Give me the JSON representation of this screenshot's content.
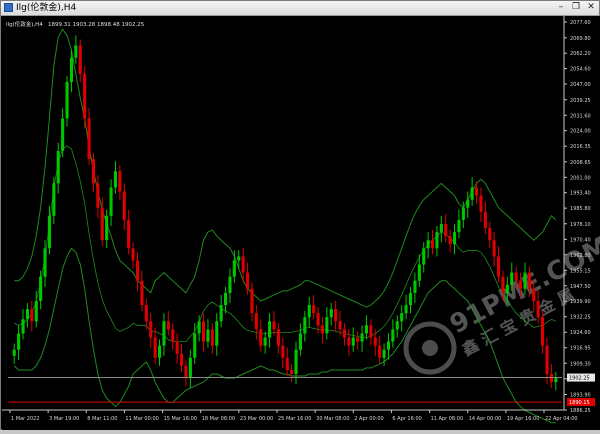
{
  "window": {
    "title": "Ilg(伦敦金),H4",
    "minimize_label": "–",
    "restore_label": "❐",
    "close_label": "✕"
  },
  "info_line": {
    "symbol": "Ilg(伦敦金),H4",
    "ohlc": "1899.31 1903.28 1898.48 1902.25"
  },
  "watermark": {
    "line1": "91PME.COM",
    "line2": "鑫 汇 宝 贵 金 属"
  },
  "colors": {
    "background": "#000000",
    "bull_candle": "#00c800",
    "bear_candle": "#e00000",
    "bands": "#1f8a1f",
    "grid_axis": "#c8c8c8",
    "bid_line": "#8a8a8a",
    "ask_line": "#e00000"
  },
  "icons": {
    "app": "chart-window-icon"
  },
  "chart_data": {
    "type": "candlestick",
    "price_levels": [
      "2077.60",
      "2069.80",
      "2062.20",
      "2054.60",
      "2047.00",
      "2039.25",
      "2031.60",
      "2024.00",
      "2016.35",
      "2008.65",
      "2001.00",
      "1993.40",
      "1985.80",
      "1978.10",
      "1970.40",
      "1962.80",
      "1955.15",
      "1947.50",
      "1939.90",
      "1932.25",
      "1924.60",
      "1916.95",
      "1909.30",
      "1901.60",
      "1893.90",
      "1886.25"
    ],
    "time_labels": [
      "1 Mar 2022",
      "3 Mar 19:00",
      "8 Mar 11:00",
      "11 Mar 00:00",
      "15 Mar 16:00",
      "18 Mar 08:00",
      "23 Mar 00:00",
      "25 Mar 16:00",
      "30 Mar 08:00",
      "2 Apr 00:00",
      "6 Apr 16:00",
      "11 Apr 08:00",
      "14 Apr 00:00",
      "19 Apr 16:00",
      "22 Apr 04:00"
    ],
    "bid_label": "1902.25",
    "ask_label": "1890.15",
    "closes": [
      1916,
      1924,
      1931,
      1936,
      1930,
      1940,
      1952,
      1966,
      1982,
      1998,
      2014,
      2030,
      2048,
      2060,
      2066,
      2052,
      2030,
      2010,
      1998,
      1986,
      1970,
      1982,
      1996,
      2004,
      1994,
      1980,
      1966,
      1960,
      1950,
      1938,
      1930,
      1922,
      1912,
      1918,
      1930,
      1926,
      1920,
      1914,
      1908,
      1902,
      1912,
      1924,
      1930,
      1920,
      1926,
      1918,
      1930,
      1938,
      1944,
      1952,
      1960,
      1962,
      1954,
      1946,
      1934,
      1926,
      1918,
      1922,
      1930,
      1926,
      1918,
      1912,
      1906,
      1904,
      1916,
      1924,
      1932,
      1938,
      1934,
      1928,
      1924,
      1932,
      1936,
      1930,
      1926,
      1922,
      1918,
      1922,
      1920,
      1924,
      1928,
      1922,
      1918,
      1912,
      1916,
      1920,
      1926,
      1930,
      1934,
      1938,
      1944,
      1950,
      1958,
      1966,
      1970,
      1966,
      1974,
      1978,
      1972,
      1968,
      1974,
      1980,
      1986,
      1990,
      1996,
      1992,
      1984,
      1976,
      1970,
      1962,
      1952,
      1944,
      1948,
      1954,
      1950,
      1946,
      1954,
      1946,
      1940,
      1932,
      1918,
      1904,
      1900,
      1902
    ],
    "upper_band": [
      1950,
      1950,
      1952,
      1956,
      1962,
      1972,
      1986,
      2006,
      2030,
      2056,
      2070,
      2074,
      2071,
      2064,
      2052,
      2040,
      2030,
      2016,
      2004,
      1994,
      1985,
      1978,
      1972,
      1965,
      1960,
      1958,
      1956,
      1954,
      1950,
      1948,
      1946,
      1944,
      1950,
      1952,
      1954,
      1952,
      1950,
      1948,
      1946,
      1944,
      1948,
      1952,
      1960,
      1970,
      1974,
      1975,
      1972,
      1970,
      1968,
      1966,
      1962,
      1956,
      1950,
      1946,
      1944,
      1942,
      1940,
      1941,
      1942,
      1943,
      1944,
      1945,
      1945,
      1946,
      1947,
      1948,
      1950,
      1950,
      1949,
      1948,
      1947,
      1946,
      1945,
      1944,
      1943,
      1942,
      1941,
      1940,
      1939,
      1938,
      1937,
      1938,
      1940,
      1942,
      1945,
      1949,
      1954,
      1960,
      1966,
      1972,
      1978,
      1983,
      1987,
      1990,
      1992,
      1994,
      1996,
      1998,
      1996,
      1994,
      1992,
      1988,
      1986,
      1990,
      1994,
      1998,
      2000,
      1998,
      1994,
      1990,
      1986,
      1984,
      1982,
      1980,
      1978,
      1976,
      1974,
      1972,
      1970,
      1972,
      1974,
      1978,
      1982,
      1980
    ],
    "lower_band": [
      1908,
      1906,
      1906,
      1906,
      1906,
      1908,
      1912,
      1918,
      1926,
      1936,
      1946,
      1956,
      1962,
      1966,
      1964,
      1958,
      1946,
      1930,
      1916,
      1904,
      1896,
      1892,
      1890,
      1888,
      1890,
      1894,
      1898,
      1904,
      1906,
      1908,
      1910,
      1906,
      1900,
      1896,
      1892,
      1890,
      1890,
      1892,
      1894,
      1896,
      1897,
      1898,
      1899,
      1900,
      1902,
      1904,
      1904,
      1903,
      1902,
      1902,
      1902,
      1903,
      1904,
      1905,
      1906,
      1907,
      1908,
      1907,
      1906,
      1906,
      1905,
      1904,
      1904,
      1903,
      1903,
      1903,
      1903,
      1904,
      1904,
      1904,
      1905,
      1905,
      1906,
      1906,
      1906,
      1906,
      1906,
      1906,
      1906,
      1906,
      1907,
      1907,
      1908,
      1909,
      1910,
      1912,
      1914,
      1917,
      1920,
      1924,
      1928,
      1932,
      1936,
      1940,
      1944,
      1946,
      1948,
      1950,
      1950,
      1948,
      1946,
      1944,
      1942,
      1940,
      1936,
      1932,
      1928,
      1924,
      1920,
      1914,
      1908,
      1902,
      1898,
      1894,
      1890,
      1888,
      1886,
      1885,
      1884,
      1883,
      1882,
      1881,
      1880,
      1880
    ]
  }
}
